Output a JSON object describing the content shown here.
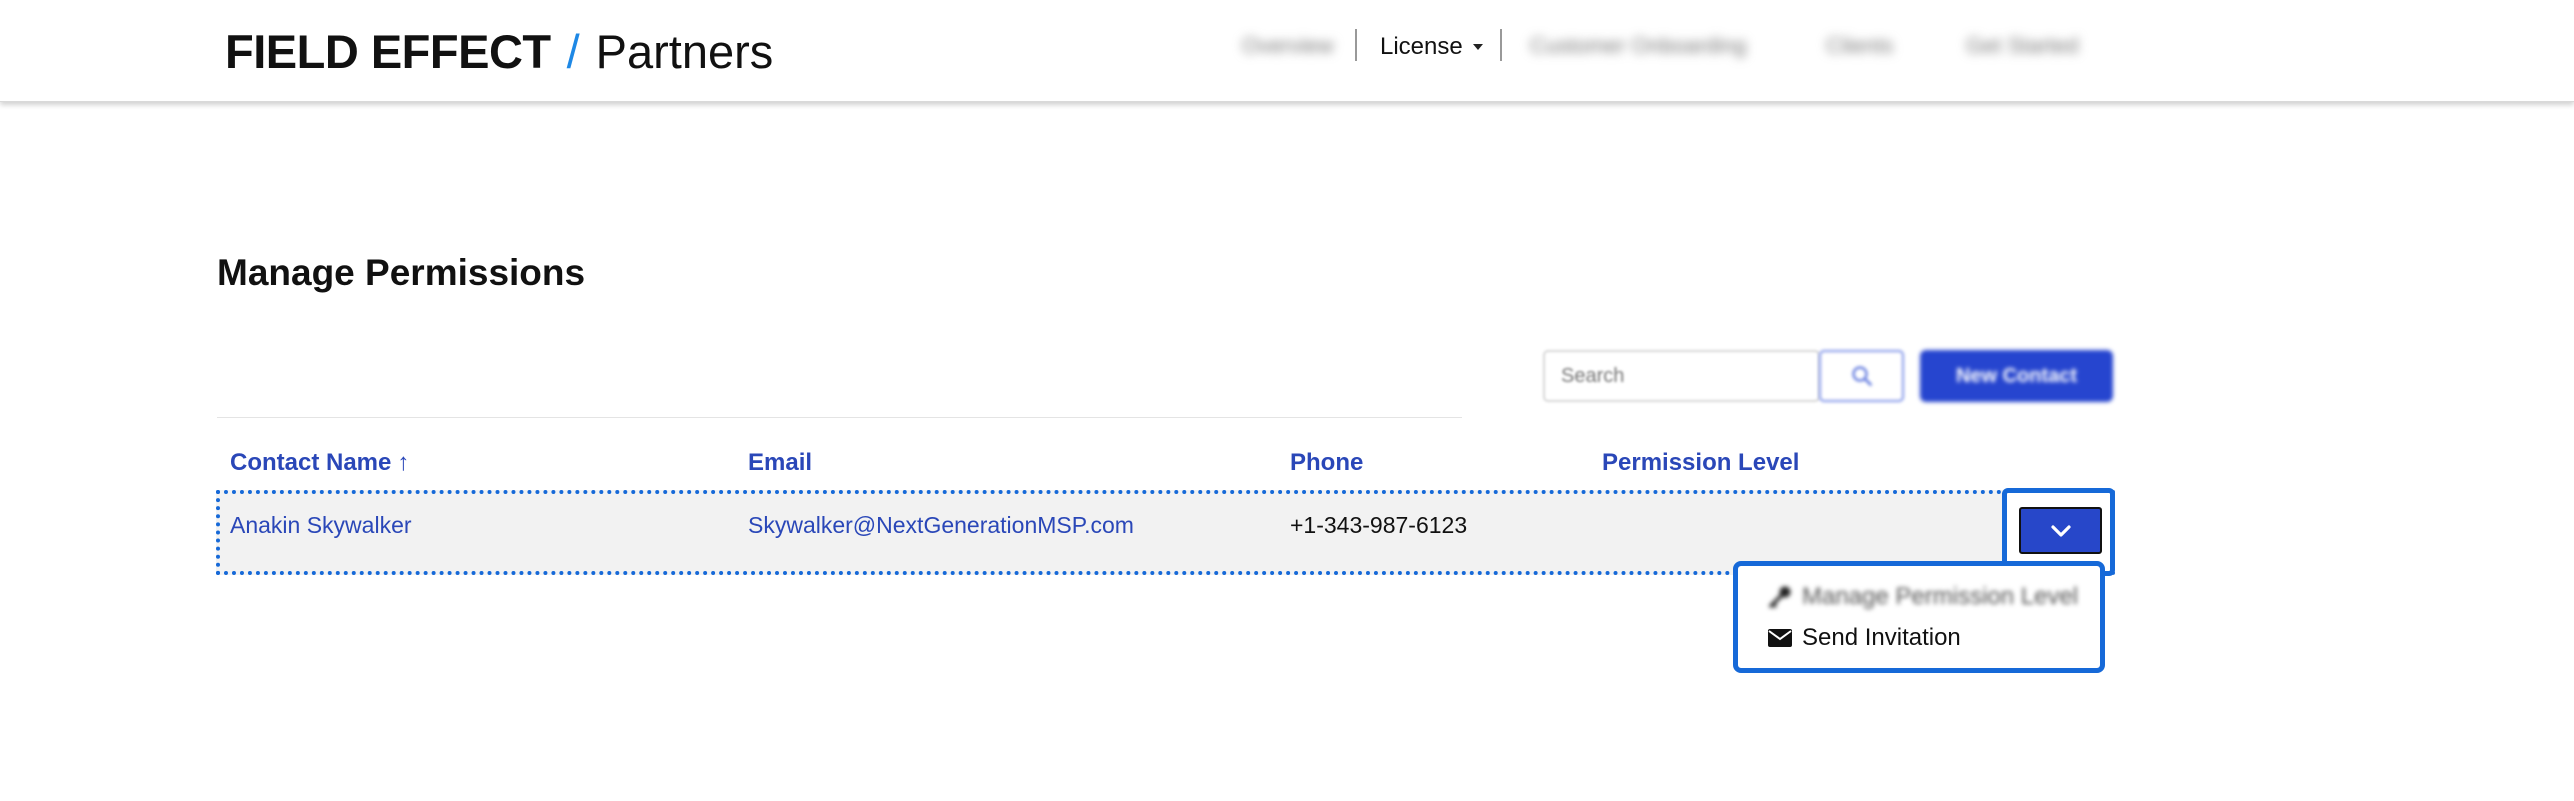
{
  "brand": {
    "name": "FIELD EFFECT",
    "slash": "/",
    "section": "Partners"
  },
  "nav": {
    "items": [
      "Overview",
      "License",
      "Customer Onboarding",
      "Clients",
      "Get Started"
    ],
    "license_label": "License"
  },
  "page": {
    "title": "Manage Permissions"
  },
  "toolbar": {
    "search_placeholder": "Search",
    "new_contact_label": "New Contact"
  },
  "table": {
    "columns": [
      "Contact Name",
      "Email",
      "Phone",
      "Permission Level"
    ],
    "sort_indicator": "↑",
    "rows": [
      {
        "name": "Anakin Skywalker",
        "email": "Skywalker@NextGenerationMSP.com",
        "phone": "+1-343-987-6123",
        "permission_level": ""
      }
    ]
  },
  "row_menu": {
    "items": [
      "Manage Permission Level",
      "Send Invitation"
    ]
  },
  "colors": {
    "accent": "#2645cf",
    "focus": "#1669d8",
    "link": "#2a47b8",
    "brand_slash": "#1e88e5"
  },
  "icons": [
    "chevron-down-icon",
    "search-icon",
    "key-icon",
    "envelope-icon",
    "caret-down-icon",
    "arrow-up-icon"
  ]
}
